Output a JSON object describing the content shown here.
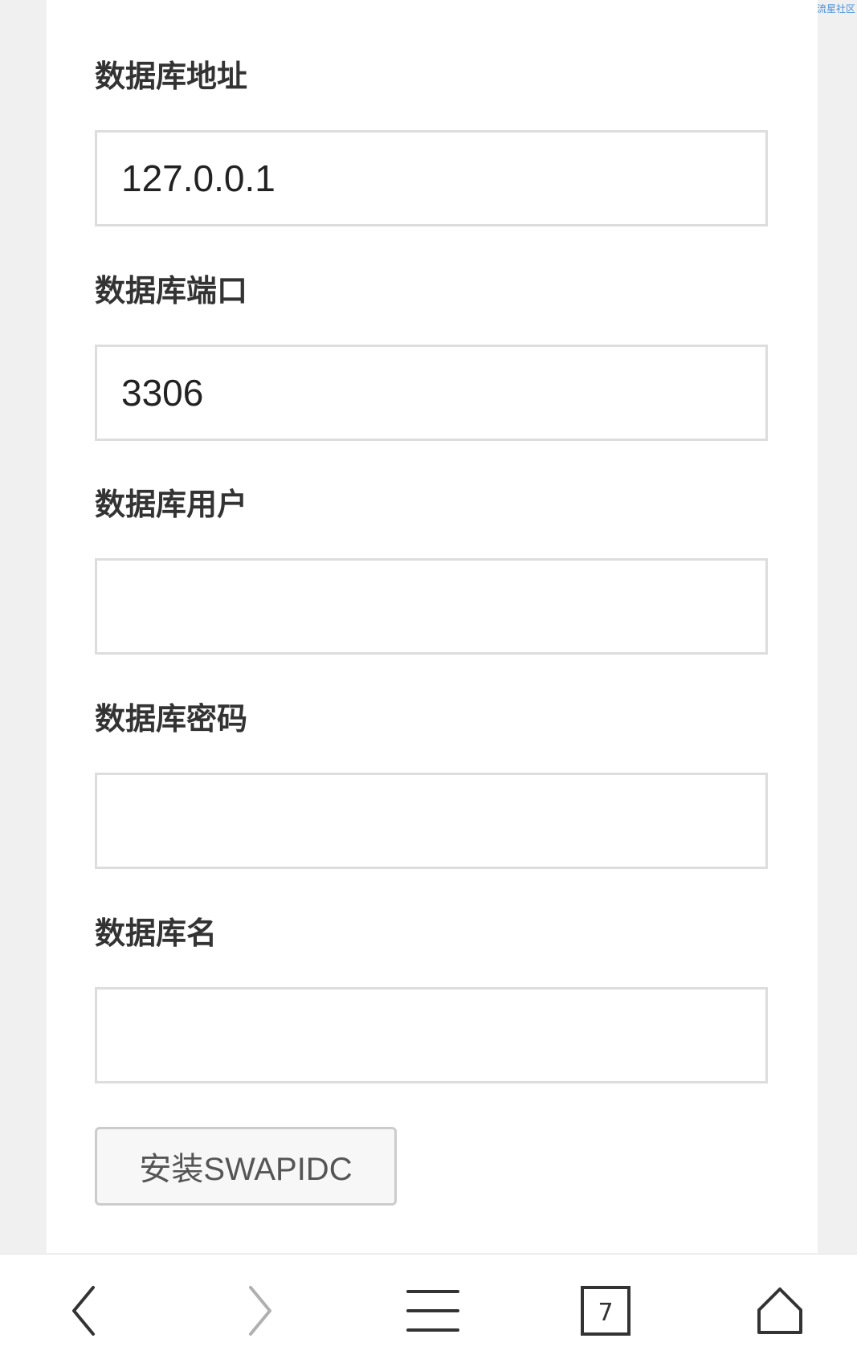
{
  "watermark": "流星社区",
  "form": {
    "fields": [
      {
        "label": "数据库地址",
        "value": "127.0.0.1"
      },
      {
        "label": "数据库端口",
        "value": "3306"
      },
      {
        "label": "数据库用户",
        "value": ""
      },
      {
        "label": "数据库密码",
        "value": ""
      },
      {
        "label": "数据库名",
        "value": ""
      }
    ],
    "submit_label": "安装SWAPIDC"
  },
  "browser_bar": {
    "tab_count": "7",
    "icons": [
      "back-icon",
      "forward-icon",
      "menu-icon",
      "tabs-icon",
      "home-icon"
    ],
    "icon_color": "#333333",
    "disabled_color": "#b0b0b0"
  }
}
